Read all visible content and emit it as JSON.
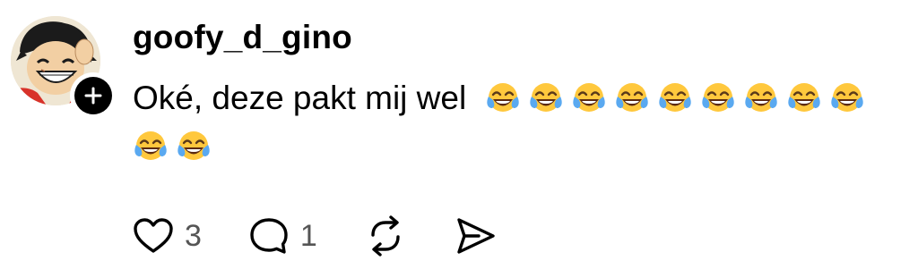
{
  "post": {
    "username": "goofy_d_gino",
    "text": "Oké, deze pakt mij wel",
    "emoji": {
      "name": "face-with-tears-of-joy",
      "row1_count": 9,
      "row2_count": 2
    }
  },
  "actions": {
    "likes": "3",
    "replies": "1"
  },
  "colors": {
    "text": "#000000",
    "muted": "#555555",
    "emoji_face": "#ffc83d",
    "emoji_tears": "#5aa9f0",
    "avatar_shirt": "#d8322a"
  },
  "icons": [
    "add-icon",
    "heart-icon",
    "comment-icon",
    "repost-icon",
    "share-icon"
  ]
}
